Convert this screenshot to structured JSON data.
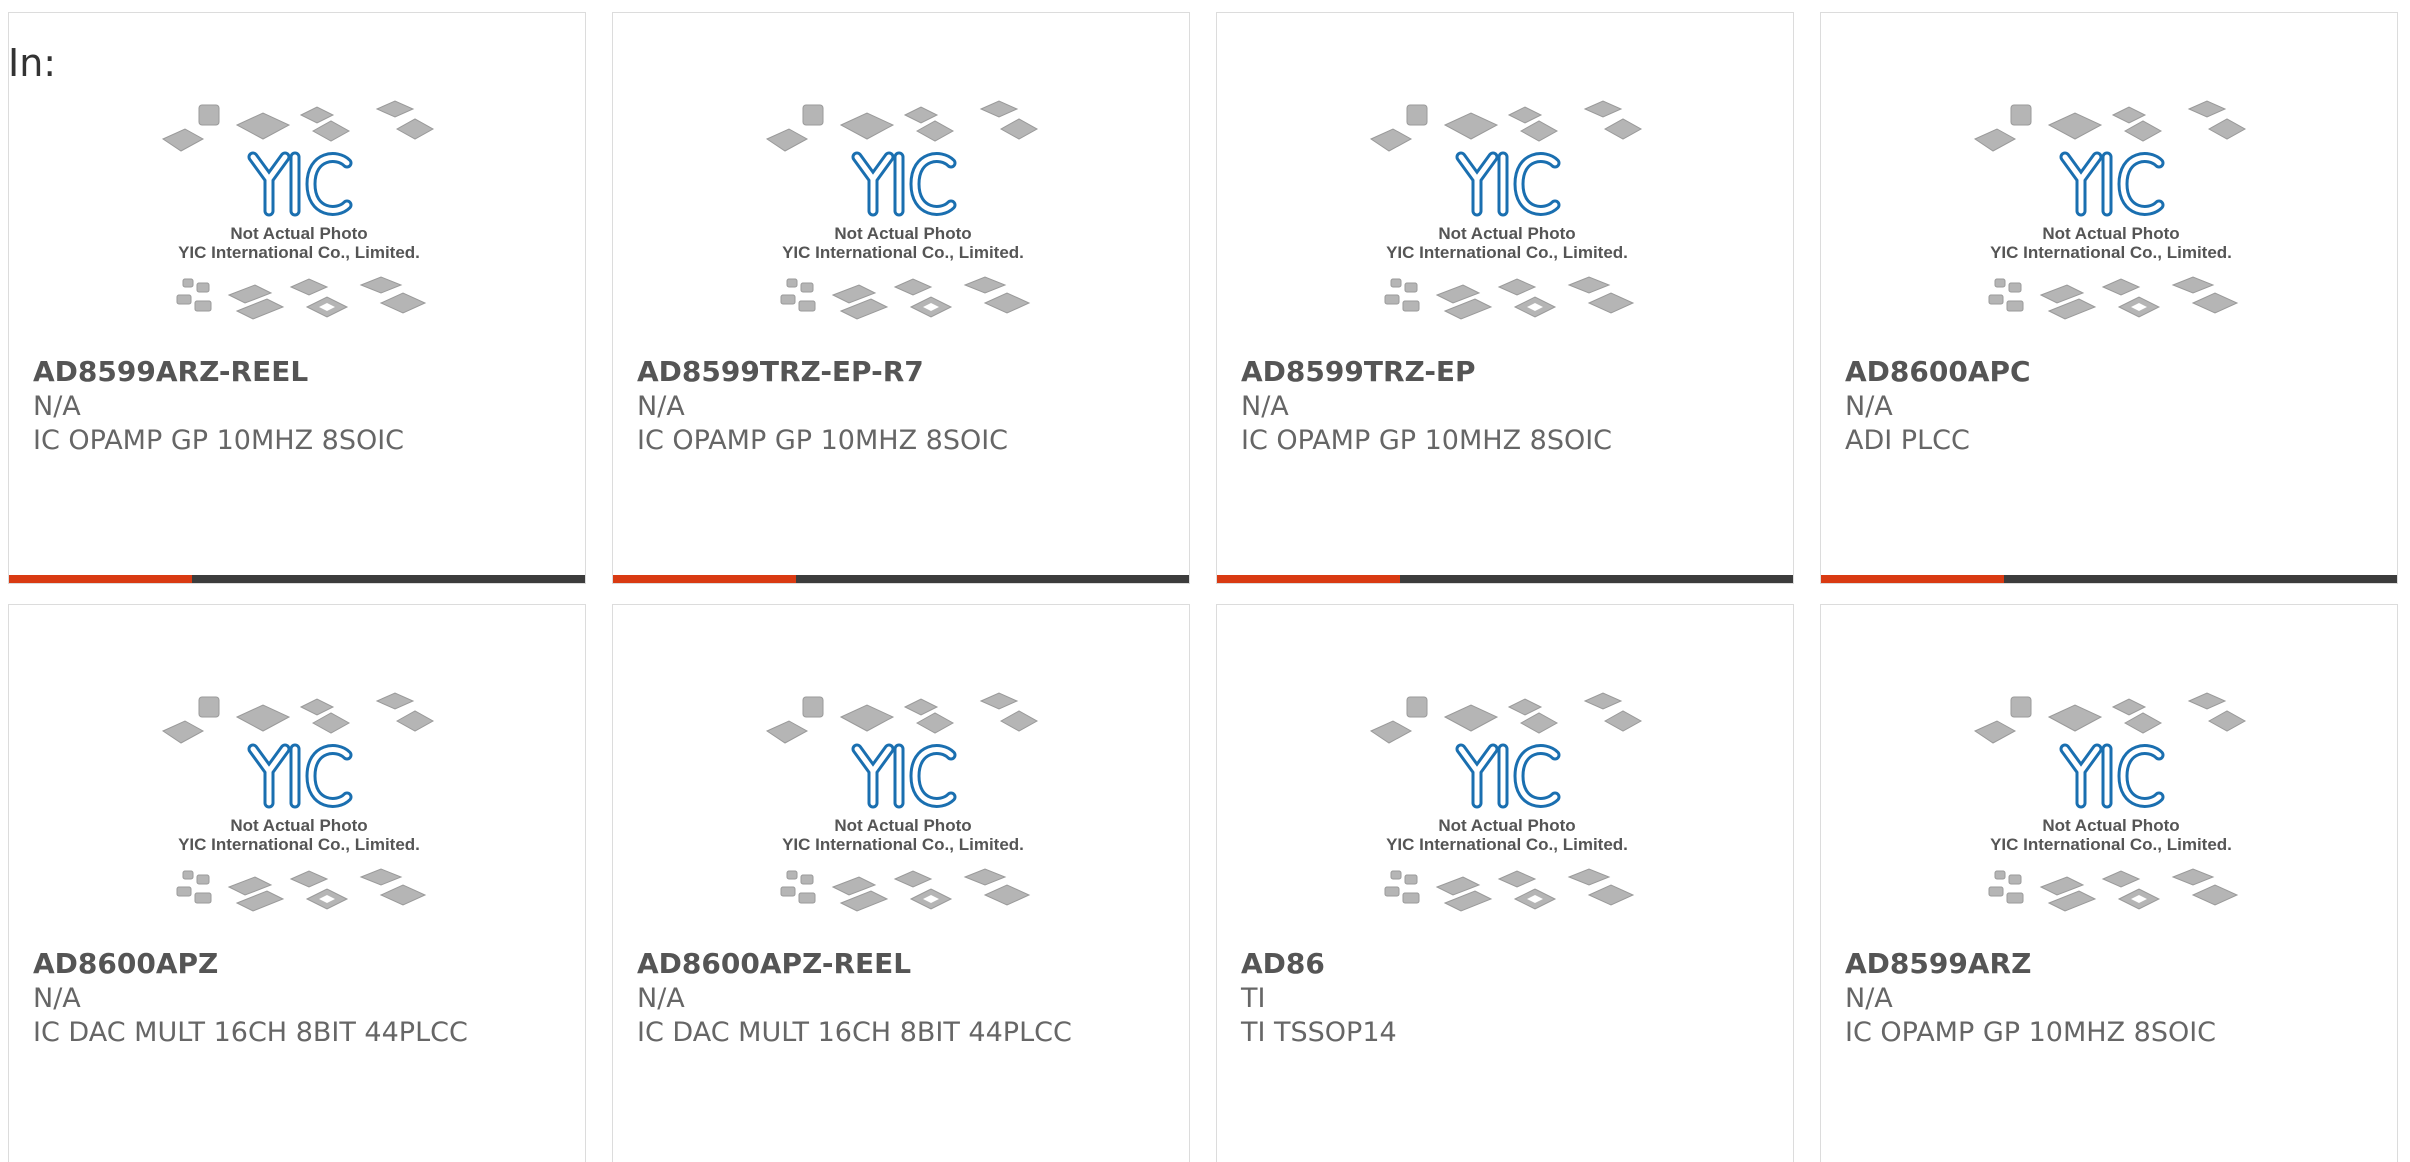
{
  "breadcrumb": {
    "label": "In:"
  },
  "image_caption": {
    "line1": "Not Actual Photo",
    "line2": "YIC International Co., Limited.",
    "logo_text": "YIC"
  },
  "colors": {
    "accent": "#d93a12",
    "bar_dark": "#3c3c3c",
    "logo_blue": "#1a8fd0"
  },
  "products": [
    {
      "part": "AD8599ARZ-REEL",
      "manufacturer": "N/A",
      "description": "IC OPAMP GP 10MHZ 8SOIC",
      "bar": true
    },
    {
      "part": "AD8599TRZ-EP-R7",
      "manufacturer": "N/A",
      "description": "IC OPAMP GP 10MHZ 8SOIC",
      "bar": true
    },
    {
      "part": "AD8599TRZ-EP",
      "manufacturer": "N/A",
      "description": "IC OPAMP GP 10MHZ 8SOIC",
      "bar": true
    },
    {
      "part": "AD8600APC",
      "manufacturer": "N/A",
      "description": "ADI PLCC",
      "bar": true
    },
    {
      "part": "AD8600APZ",
      "manufacturer": "N/A",
      "description": "IC DAC MULT 16CH 8BIT 44PLCC",
      "bar": false
    },
    {
      "part": "AD8600APZ-REEL",
      "manufacturer": "N/A",
      "description": "IC DAC MULT 16CH 8BIT 44PLCC",
      "bar": false
    },
    {
      "part": "AD86",
      "manufacturer": "TI",
      "description": "TI TSSOP14",
      "bar": false
    },
    {
      "part": "AD8599ARZ",
      "manufacturer": "N/A",
      "description": "IC OPAMP GP 10MHZ 8SOIC",
      "bar": false
    }
  ]
}
